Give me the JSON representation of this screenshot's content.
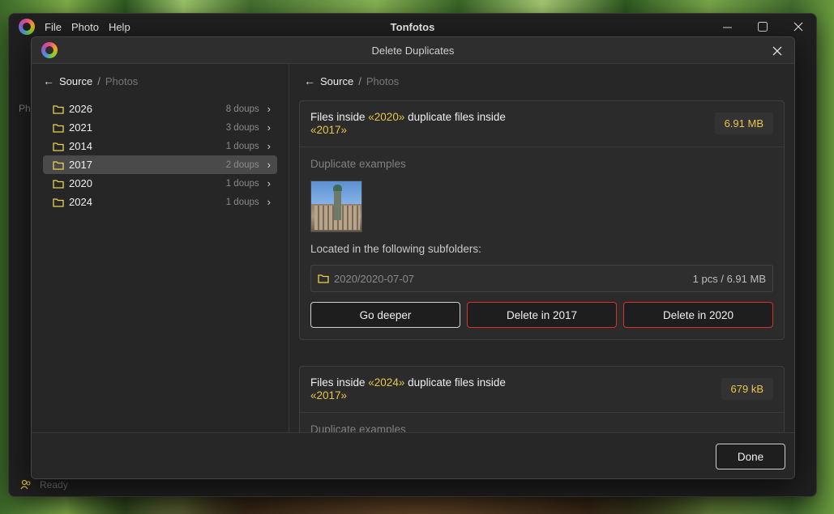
{
  "app": {
    "title": "Tonfotos",
    "menu": [
      "File",
      "Photo",
      "Help"
    ],
    "status": "Ready",
    "bg_label": "Ph"
  },
  "dialog": {
    "title": "Delete Duplicates",
    "left_breadcrumb": {
      "current": "Source",
      "separator": "/",
      "next": "Photos"
    },
    "right_breadcrumb": {
      "current": "Source",
      "separator": "/",
      "next": "Photos"
    },
    "folders": [
      {
        "name": "2026",
        "count": "8 doups",
        "selected": false
      },
      {
        "name": "2021",
        "count": "3 doups",
        "selected": false
      },
      {
        "name": "2014",
        "count": "1 doups",
        "selected": false
      },
      {
        "name": "2017",
        "count": "2 doups",
        "selected": true
      },
      {
        "name": "2020",
        "count": "1 doups",
        "selected": false
      },
      {
        "name": "2024",
        "count": "1 doups",
        "selected": false
      }
    ],
    "cards": [
      {
        "prefix": "Files inside ",
        "source": "«2020»",
        "middle": " duplicate files inside",
        "target": "«2017»",
        "size": "6.91 MB",
        "dup_label": "Duplicate examples",
        "sub_label": "Located in the following subfolders:",
        "subfolder_path": "2020/2020-07-07",
        "subfolder_stats": "1 pcs / 6.91 MB",
        "btn_deeper": "Go deeper",
        "btn_delete_a": "Delete in 2017",
        "btn_delete_b": "Delete in 2020"
      },
      {
        "prefix": "Files inside ",
        "source": "«2024»",
        "middle": " duplicate files inside",
        "target": "«2017»",
        "size": "679 kB",
        "dup_label": "Duplicate examples"
      }
    ],
    "done_label": "Done"
  },
  "colors": {
    "accent_yellow": "#e8c64a",
    "danger_red": "#d93030",
    "folder_yellow": "#e8d34a"
  }
}
